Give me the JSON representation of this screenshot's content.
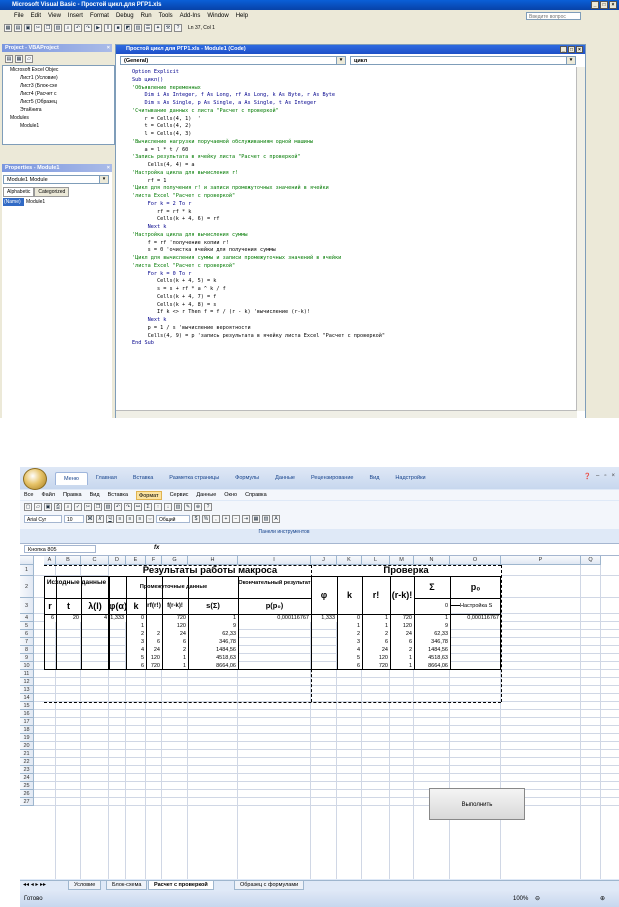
{
  "vba": {
    "title": "Microsoft Visual Basic - Простой цикл.для РГР1.xls",
    "menu": [
      "File",
      "Edit",
      "View",
      "Insert",
      "Format",
      "Debug",
      "Run",
      "Tools",
      "Add-Ins",
      "Window",
      "Help"
    ],
    "help_placeholder": "Введите вопрос",
    "cursor_pos": "Ln 37, Col 1",
    "project": {
      "title": "Project - VBAProject",
      "items": [
        "Microsoft Excel Objec",
        "Лист1 (Условие)",
        "Лист3 (Блок-схе",
        "Лист4 (Расчет с",
        "Лист5 (Образец",
        "ЭтаКнига",
        "Modules",
        "Module1"
      ]
    },
    "properties": {
      "title": "Properties - Module1",
      "object": "Module1  Module",
      "tabs": [
        "Alphabetic",
        "Categorized"
      ],
      "prop_name": "(Name)",
      "prop_value": "Module1"
    },
    "code_window": {
      "title": "Простой цикл для РГР1.xls - Module1 (Code)",
      "object_combo": "(General)",
      "proc_combo": "цикл",
      "lines": [
        {
          "t": "Option Explicit",
          "k": 1
        },
        {
          "t": "Sub цикл()",
          "k": 1
        },
        {
          "t": "'Объявление переменных",
          "k": 2
        },
        {
          "t": "    Dim i As Integer, f As Long, rf As Long, k As Byte, r As Byte",
          "k": 1
        },
        {
          "t": "    Dim s As Single, p As Single, a As Single, t As Integer",
          "k": 1
        },
        {
          "t": "'Считывание данных с листа \"Расчет с проверкой\"",
          "k": 2
        },
        {
          "t": "    r = Cells(4, 1)  '",
          "k": 0
        },
        {
          "t": "    t = Cells(4, 2)",
          "k": 0
        },
        {
          "t": "    l = Cells(4, 3)",
          "k": 0
        },
        {
          "t": "'Вычисление нагрузки поручаемой обслуживаниям одной машины",
          "k": 2
        },
        {
          "t": "    a = l * t / 60",
          "k": 0
        },
        {
          "t": "'Запись результата в ячейку листа \"Расчет с проверкой\"",
          "k": 2
        },
        {
          "t": "     Cells(4, 4) = a",
          "k": 0
        },
        {
          "t": "'Настройка цикла для вычисления r!",
          "k": 2
        },
        {
          "t": "     rf = 1",
          "k": 0
        },
        {
          "t": "'Цикл для получения r! и записи промежуточных значений в ячейки",
          "k": 2
        },
        {
          "t": "'листа Excel \"Расчет с проверкой\"",
          "k": 2
        },
        {
          "t": "     For k = 2 To r",
          "k": 1
        },
        {
          "t": "        rf = rf * k",
          "k": 0
        },
        {
          "t": "        Cells(k + 4, 6) = rf",
          "k": 0
        },
        {
          "t": "     Next k",
          "k": 1
        },
        {
          "t": "'Настройка цикла для вычисления суммы",
          "k": 2
        },
        {
          "t": "     f = rf 'получение копии r!",
          "k": 0
        },
        {
          "t": "     s = 0 'очистка ячейки для получения суммы",
          "k": 0
        },
        {
          "t": "'Цикл для вычисления суммы и записи промежуточных значений в ячейки",
          "k": 2
        },
        {
          "t": "'листа Excel \"Расчет с проверкой\"",
          "k": 2
        },
        {
          "t": "     For k = 0 To r",
          "k": 1
        },
        {
          "t": "        Cells(k + 4, 5) = k",
          "k": 0
        },
        {
          "t": "        s = s + rf * a ^ k / f",
          "k": 0
        },
        {
          "t": "        Cells(k + 4, 7) = f",
          "k": 0
        },
        {
          "t": "        Cells(k + 4, 8) = s",
          "k": 0
        },
        {
          "t": "        If k <> r Then f = f / (r - k) 'вычисление (r-k)!",
          "k": 0
        },
        {
          "t": "     Next k",
          "k": 1
        },
        {
          "t": "     p = 1 / s 'вычисление вероятности",
          "k": 0
        },
        {
          "t": "     Cells(4, 9) = p 'запись результата в ячейку листа Excel \"Расчет с проверкой\"",
          "k": 0
        },
        {
          "t": "End Sub",
          "k": 1
        }
      ]
    }
  },
  "excel": {
    "ribbon_tabs": [
      "Меню",
      "Главная",
      "Вставка",
      "Разметка страницы",
      "Формулы",
      "Данные",
      "Рецензирование",
      "Вид",
      "Надстройки"
    ],
    "menu": [
      "Все",
      "Файл",
      "Правка",
      "Вид",
      "Вставка",
      "Формат",
      "Сервис",
      "Данные",
      "Окно",
      "Справка"
    ],
    "font_name": "Arial Cyr",
    "font_size": "10",
    "number_format": "Общий",
    "panel_label": "Панели инструментов",
    "namebox": "Кнопка 805",
    "columns": [
      "A",
      "B",
      "C",
      "D",
      "E",
      "F",
      "G",
      "H",
      "I",
      "J",
      "K",
      "L",
      "M",
      "N",
      "O",
      "P",
      "Q"
    ],
    "rows": [
      "1",
      "2",
      "3",
      "4",
      "5",
      "6",
      "7",
      "8",
      "9",
      "10",
      "11",
      "12",
      "13",
      "14",
      "15",
      "16",
      "17",
      "18",
      "19",
      "20",
      "21",
      "22",
      "23",
      "24",
      "25",
      "26",
      "27"
    ],
    "headers": {
      "results_title": "Результаты работы макроса",
      "check_title": "Проверка",
      "source_data": "Исходные данные",
      "intermediate": "Промежуточные данные",
      "final_result": "Окончательный результат",
      "phi_a": "φ(α)",
      "phi": "φ",
      "k": "k",
      "rf": "rf(r!)",
      "frk": "f(r-k)!",
      "s_sigma": "s(Σ)",
      "p_p0": "p(p₀)",
      "r": "r",
      "t": "t",
      "lambda": "λ(l)",
      "r_fact": "r!",
      "rk_fact": "(r-k)!",
      "sigma": "Σ",
      "p0": "p₀"
    },
    "setup_value": "0",
    "setup_label": "Настройка S",
    "inputs": {
      "r": "6",
      "t": "20",
      "l": "4",
      "phi_a": "1,333",
      "p": "0,000116767",
      "phi": "1,333",
      "p0": "0,000116767"
    },
    "result_rows": [
      {
        "k": "0",
        "rf": "",
        "frk": "720",
        "s": "1",
        "ck": "0",
        "cr": "1",
        "crk": "720",
        "cs": "1"
      },
      {
        "k": "1",
        "rf": "",
        "frk": "120",
        "s": "9",
        "ck": "1",
        "cr": "1",
        "crk": "120",
        "cs": "9"
      },
      {
        "k": "2",
        "rf": "2",
        "frk": "24",
        "s": "62,33",
        "ck": "2",
        "cr": "2",
        "crk": "24",
        "cs": "62,33"
      },
      {
        "k": "3",
        "rf": "6",
        "frk": "6",
        "s": "346,78",
        "ck": "3",
        "cr": "6",
        "crk": "6",
        "cs": "346,78"
      },
      {
        "k": "4",
        "rf": "24",
        "frk": "2",
        "s": "1484,56",
        "ck": "4",
        "cr": "24",
        "crk": "2",
        "cs": "1484,56"
      },
      {
        "k": "5",
        "rf": "120",
        "frk": "1",
        "s": "4518,63",
        "ck": "5",
        "cr": "120",
        "crk": "1",
        "cs": "4518,63"
      },
      {
        "k": "6",
        "rf": "720",
        "frk": "1",
        "s": "8664,06",
        "ck": "6",
        "cr": "720",
        "crk": "1",
        "cs": "8664,06"
      }
    ],
    "run_button": "Выполнить",
    "sheet_tabs": [
      "Условие",
      "Блок-схема",
      "Расчет с проверкой",
      "Образец с формулами"
    ],
    "status": "Готово",
    "zoom": "100%"
  }
}
